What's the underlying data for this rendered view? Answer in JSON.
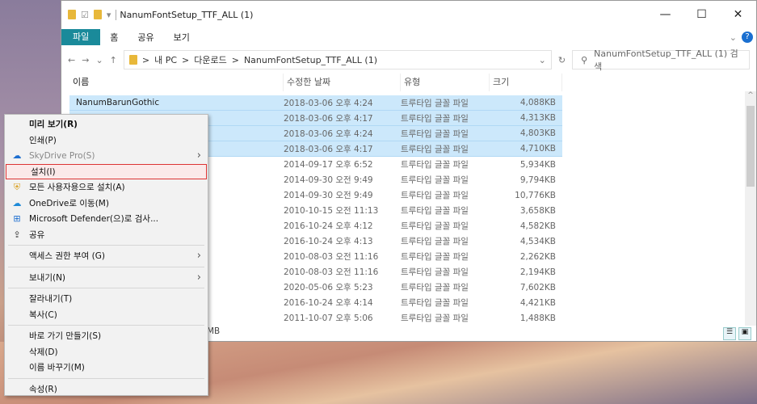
{
  "window": {
    "title": "NanumFontSetup_TTF_ALL (1)",
    "minimize": "—",
    "maximize": "☐",
    "close": "✕"
  },
  "ribbon": {
    "tabs": [
      "파일",
      "홈",
      "공유",
      "보기"
    ]
  },
  "address": {
    "back": "←",
    "forward": "→",
    "recent": "⌄",
    "up": "↑",
    "path": [
      "내 PC",
      "다운로드",
      "NanumFontSetup_TTF_ALL (1)"
    ],
    "sep": ">",
    "dropdown": "⌄",
    "refresh": "↻",
    "search_placeholder": "NanumFontSetup_TTF_ALL (1) 검색"
  },
  "columns": [
    "이름",
    "수정한 날짜",
    "유형",
    "크기"
  ],
  "files": [
    {
      "name": "NanumBarunGothic",
      "date": "2018-03-06 오후 4:24",
      "type": "트루타입 글꼴 파일",
      "size": "4,088KB",
      "selected": true
    },
    {
      "name": "",
      "date": "2018-03-06 오후 4:17",
      "type": "트루타입 글꼴 파일",
      "size": "4,313KB",
      "selected": true
    },
    {
      "name": "",
      "date": "2018-03-06 오후 4:24",
      "type": "트루타입 글꼴 파일",
      "size": "4,803KB",
      "selected": true
    },
    {
      "name": "",
      "date": "2018-03-06 오후 4:17",
      "type": "트루타입 글꼴 파일",
      "size": "4,710KB",
      "selected": true
    },
    {
      "name": "",
      "date": "2014-09-17 오후 6:52",
      "type": "트루타입 글꼴 파일",
      "size": "5,934KB"
    },
    {
      "name": "",
      "date": "2014-09-30 오전 9:49",
      "type": "트루타입 글꼴 파일",
      "size": "9,794KB"
    },
    {
      "name": "",
      "date": "2014-09-30 오전 9:49",
      "type": "트루타입 글꼴 파일",
      "size": "10,776KB"
    },
    {
      "name": "",
      "date": "2010-10-15 오전 11:13",
      "type": "트루타입 글꼴 파일",
      "size": "3,658KB"
    },
    {
      "name": "",
      "date": "2016-10-24 오후 4:12",
      "type": "트루타입 글꼴 파일",
      "size": "4,582KB"
    },
    {
      "name": "",
      "date": "2016-10-24 오후 4:13",
      "type": "트루타입 글꼴 파일",
      "size": "4,534KB"
    },
    {
      "name": "",
      "date": "2010-08-03 오전 11:16",
      "type": "트루타입 글꼴 파일",
      "size": "2,262KB"
    },
    {
      "name": "",
      "date": "2010-08-03 오전 11:16",
      "type": "트루타입 글꼴 파일",
      "size": "2,194KB"
    },
    {
      "name": "",
      "date": "2020-05-06 오후 5:23",
      "type": "트루타입 글꼴 파일",
      "size": "7,602KB"
    },
    {
      "name": "",
      "date": "2016-10-24 오후 4:14",
      "type": "트루타입 글꼴 파일",
      "size": "4,421KB"
    },
    {
      "name": "",
      "date": "2011-10-07 오후 5:06",
      "type": "트루타입 글꼴 파일",
      "size": "1,488KB"
    }
  ],
  "status": {
    "text": "MB"
  },
  "context_menu": [
    {
      "label": "미리 보기(R)",
      "bold": true
    },
    {
      "label": "인쇄(P)"
    },
    {
      "label": "SkyDrive Pro(S)",
      "icon": "cloud-icon",
      "submenu": true,
      "disabled": true
    },
    {
      "label": "설치(I)",
      "highlighted": true
    },
    {
      "label": "모든 사용자용으로 설치(A)",
      "icon": "shield-icon"
    },
    {
      "label": "OneDrive로 이동(M)",
      "icon": "onedrive-icon"
    },
    {
      "label": "Microsoft Defender(으)로 검사...",
      "icon": "defender-icon"
    },
    {
      "label": "공유",
      "icon": "share-icon"
    },
    {
      "sep": true
    },
    {
      "label": "액세스 권한 부여 (G)",
      "submenu": true
    },
    {
      "sep": true
    },
    {
      "label": "보내기(N)",
      "submenu": true
    },
    {
      "sep": true
    },
    {
      "label": "잘라내기(T)"
    },
    {
      "label": "복사(C)"
    },
    {
      "sep": true
    },
    {
      "label": "바로 가기 만들기(S)"
    },
    {
      "label": "삭제(D)"
    },
    {
      "label": "이름 바꾸기(M)"
    },
    {
      "sep": true
    },
    {
      "label": "속성(R)"
    }
  ],
  "colors": {
    "accent": "#1a8a9a",
    "selection": "#cce8fb",
    "highlight_border": "#dd3333"
  }
}
